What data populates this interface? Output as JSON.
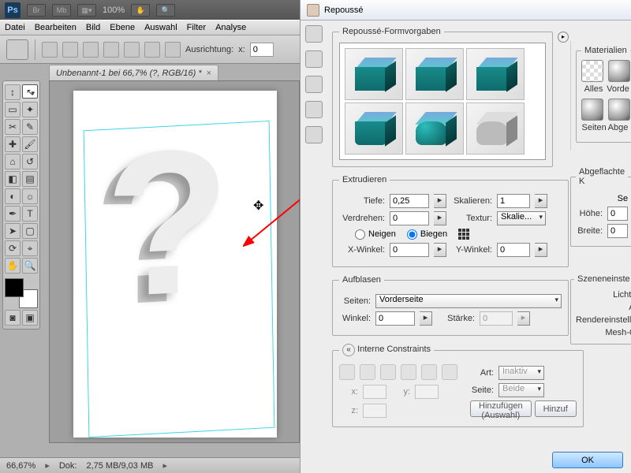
{
  "app": {
    "zoom_label": "100%",
    "br": "Br",
    "mb": "Mb",
    "ps": "Ps"
  },
  "menu": {
    "datei": "Datei",
    "bearbeiten": "Bearbeiten",
    "bild": "Bild",
    "ebene": "Ebene",
    "auswahl": "Auswahl",
    "filter": "Filter",
    "analyse": "Analyse"
  },
  "options": {
    "ausrichtung_label": "Ausrichtung:",
    "x_label": "x:",
    "x_value": "0"
  },
  "document_tab": {
    "title": "Unbenannt-1 bei 66,7% (?, RGB/16) *"
  },
  "status": {
    "zoom": "66,67%",
    "doc_label": "Dok:",
    "doc_value": "2,75 MB/9,03 MB"
  },
  "dialog": {
    "title": "Repoussé",
    "presets_legend": "Repoussé-Formvorgaben",
    "extrude": {
      "legend": "Extrudieren",
      "tiefe_label": "Tiefe:",
      "tiefe_value": "0,25",
      "skalieren_label": "Skalieren:",
      "skalieren_value": "1",
      "verdrehen_label": "Verdrehen:",
      "verdrehen_value": "0",
      "textur_label": "Textur:",
      "textur_value": "Skalie...",
      "neigen_label": "Neigen",
      "biegen_label": "Biegen",
      "xwinkel_label": "X-Winkel:",
      "xwinkel_value": "0",
      "ywinkel_label": "Y-Winkel:",
      "ywinkel_value": "0"
    },
    "inflate": {
      "legend": "Aufblasen",
      "seiten_label": "Seiten:",
      "seiten_value": "Vorderseite",
      "winkel_label": "Winkel:",
      "winkel_value": "0",
      "staerke_label": "Stärke:",
      "staerke_value": "0"
    },
    "materials": {
      "legend": "Materialien",
      "alles": "Alles",
      "vorder": "Vorde",
      "seiten": "Seiten",
      "abge": "Abge"
    },
    "bevel": {
      "legend": "Abgeflachte K",
      "se_label": "Se",
      "hoehe_label": "Höhe:",
      "hoehe_value": "0",
      "breite_label": "Breite:",
      "breite_value": "0"
    },
    "scene": {
      "legend": "Szeneneinste",
      "lichtque": "Lichtque",
      "ansi": "Ansi",
      "render": "Rendereinstellung",
      "mesh": "Mesh-Qua"
    },
    "constraints": {
      "legend": "Interne Constraints",
      "art_label": "Art:",
      "art_value": "Inaktiv",
      "seite_label": "Seite:",
      "seite_value": "Beide",
      "x": "x:",
      "y": "y:",
      "z": "z:",
      "add_sel": "Hinzufügen (Auswahl)",
      "add": "Hinzuf"
    },
    "ok": "OK"
  }
}
